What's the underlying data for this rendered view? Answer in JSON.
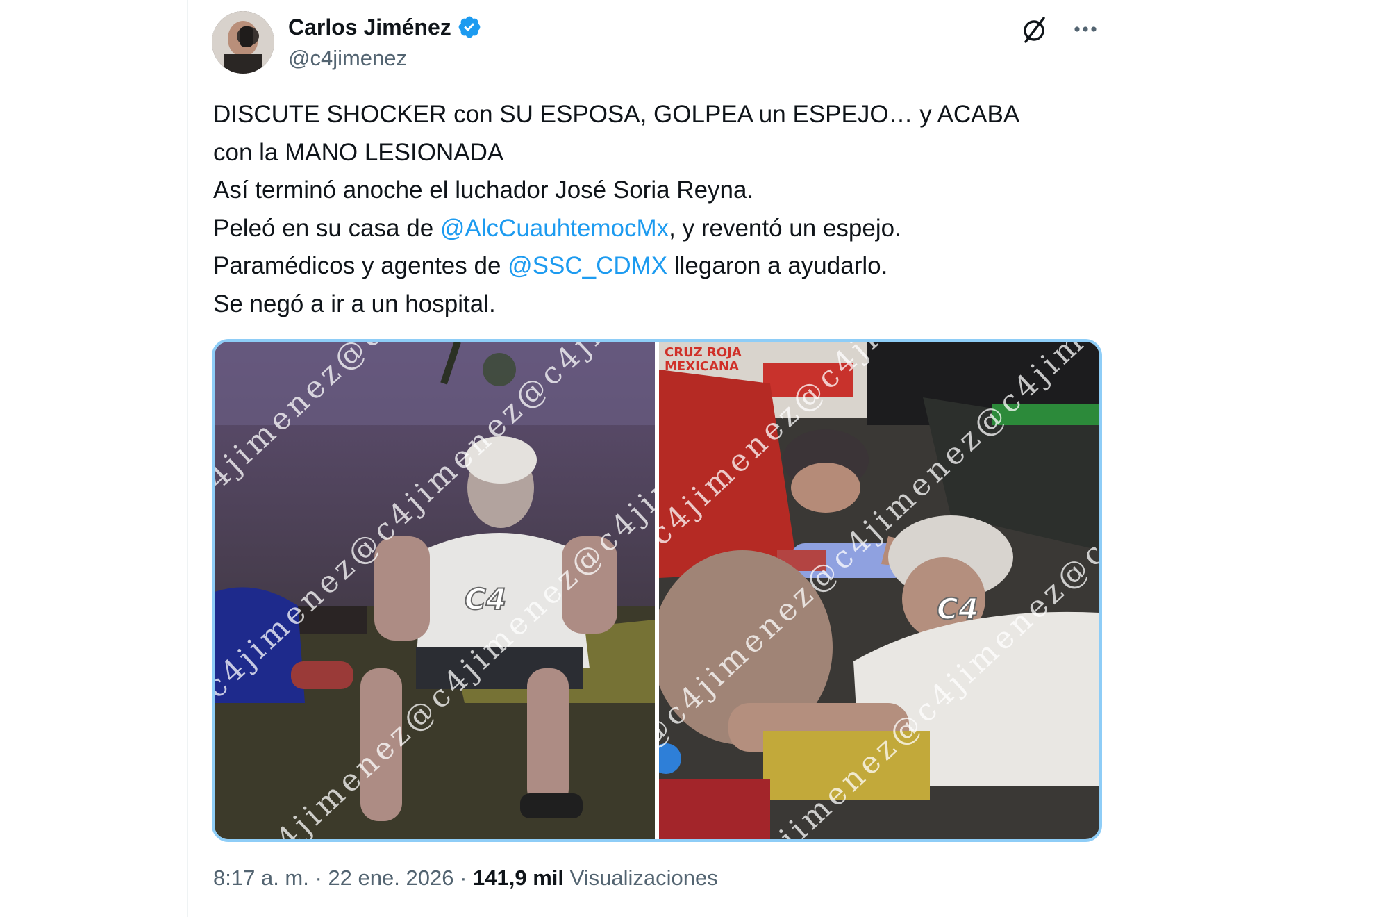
{
  "author": {
    "display_name": "Carlos Jiménez",
    "handle": "@c4jimenez",
    "verified": true,
    "avatar_desc": "avatar-photo"
  },
  "actions": {
    "grok_icon": "grok-slash-icon",
    "more_icon": "more-horizontal-icon"
  },
  "tweet": {
    "line1": "DISCUTE SHOCKER con SU ESPOSA, GOLPEA un ESPEJO… y ACABA",
    "line2": "con la MANO LESIONADA",
    "line3": "Así terminó anoche el luchador José Soria Reyna.",
    "line4_before": "Peleó en su casa de ",
    "line4_mention": "@AlcCuauhtemocMx",
    "line4_after": ", y reventó un espejo.",
    "line5_before": "Paramédicos y agentes de ",
    "line5_mention": "@SSC_CDMX",
    "line5_after": " llegaron a ayudarlo.",
    "line6": "Se negó a ir a un hospital."
  },
  "media": {
    "watermark": "@c4jimenez@c4jimenez@c4jimenez",
    "logo": "C4",
    "right_sign": "CRUZ ROJA MEXICANA"
  },
  "meta": {
    "time": "8:17 a. m.",
    "separator": "·",
    "date": "22 ene. 2026",
    "views_count": "141,9 mil",
    "views_label": "Visualizaciones"
  },
  "colors": {
    "link": "#1d9bf0",
    "verified": "#1d9bf0",
    "secondary_text": "#536471",
    "media_border": "#8ecdf7"
  }
}
